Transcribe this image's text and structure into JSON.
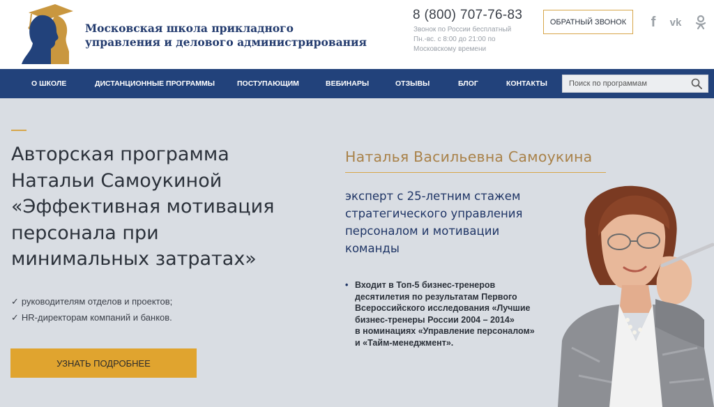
{
  "header": {
    "school_name_line1": "Московская школа прикладного",
    "school_name_line2": "управления и делового администрирования",
    "phone": "8 (800) 707-76-83",
    "phone_note_line1": "Звонок по России бесплатный",
    "phone_note_line2": "Пн.-вс. с 8:00 до 21:00 по",
    "phone_note_line3": "Московскому времени",
    "callback_label": "ОБРАТНЫЙ ЗВОНОК",
    "social": {
      "fb": "f",
      "vk": "vk",
      "ok": "ok"
    }
  },
  "nav": {
    "items": [
      {
        "label": "О ШКОЛЕ"
      },
      {
        "label": "ДИСТАНЦИОННЫЕ ПРОГРАММЫ"
      },
      {
        "label": "ПОСТУПАЮЩИМ"
      },
      {
        "label": "ВЕБИНАРЫ"
      },
      {
        "label": "ОТЗЫВЫ"
      },
      {
        "label": "БЛОГ"
      },
      {
        "label": "КОНТАКТЫ"
      }
    ],
    "search_placeholder": "Поиск по программам"
  },
  "hero": {
    "title_lines": [
      "Авторская программа",
      "Натальи Самоукиной",
      "«Эффективная мотивация",
      "персонала при",
      "минимальных затратах»"
    ],
    "audience": [
      "руководителям отделов и проектов;",
      "HR-директорам компаний и банков."
    ],
    "cta_label": "УЗНАТЬ ПОДРОБНЕЕ"
  },
  "expert": {
    "name": "Наталья Васильевна Самоукина",
    "desc_lines": [
      "эксперт с 25-летним стажем",
      "стратегического управления",
      "персоналом и мотивации",
      "команды"
    ],
    "bullet_lines": [
      "Входит в Топ-5 бизнес-тренеров",
      "десятилетия по результатам Первого",
      "Всероссийского исследования «Лучшие",
      "бизнес-тренеры России 2004 – 2014»",
      "в номинациях «Управление персоналом»",
      "и «Тайм-менеджмент»."
    ]
  },
  "colors": {
    "brand_blue": "#22427b",
    "accent_gold": "#d7a64a",
    "cta_yellow": "#e0a42f",
    "background": "#d9dde3"
  },
  "icons": {
    "logo": "graduate-silhouette-logo",
    "search": "search-icon",
    "check": "check-icon"
  }
}
